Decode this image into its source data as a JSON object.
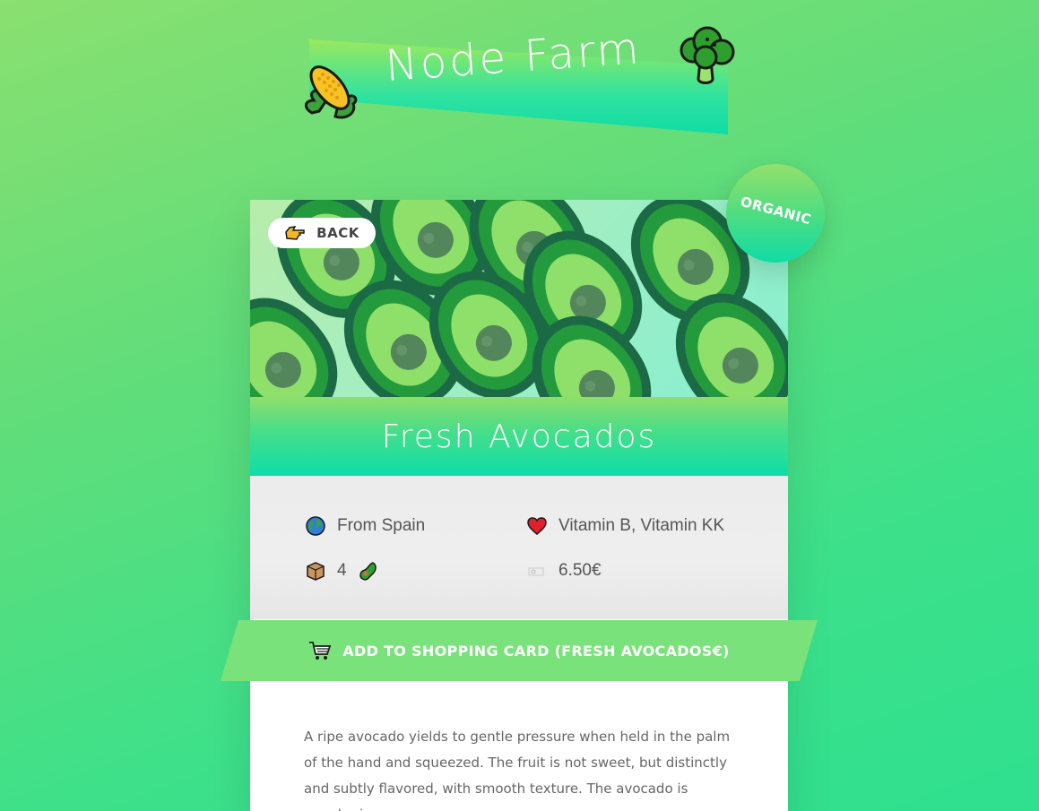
{
  "header": {
    "title": "Node Farm",
    "left_icon": "corn-icon",
    "right_icon": "broccoli-icon"
  },
  "product": {
    "image_icon": "avocado-pattern",
    "back_label": "BACK",
    "back_icon": "pointing-hand-icon",
    "organic_label": "ORGANIC",
    "name": "Fresh Avocados",
    "origin": "From Spain",
    "nutrients": "Vitamin B, Vitamin KK",
    "quantity": "4",
    "price": "6.50€",
    "cart_label": "ADD TO SHOPPING CARD (FRESH AVOCADOS€)",
    "description": "A ripe avocado yields to gentle pressure when held in the palm of the hand and squeezed. The fruit is not sweet, but distinctly and subtly flavored, with smooth texture. The avocado is popular in"
  },
  "colors": {
    "background_start": "#8ae070",
    "background_end": "#2fe08f",
    "accent": "#10dca6",
    "cart_band": "#79e27a"
  }
}
